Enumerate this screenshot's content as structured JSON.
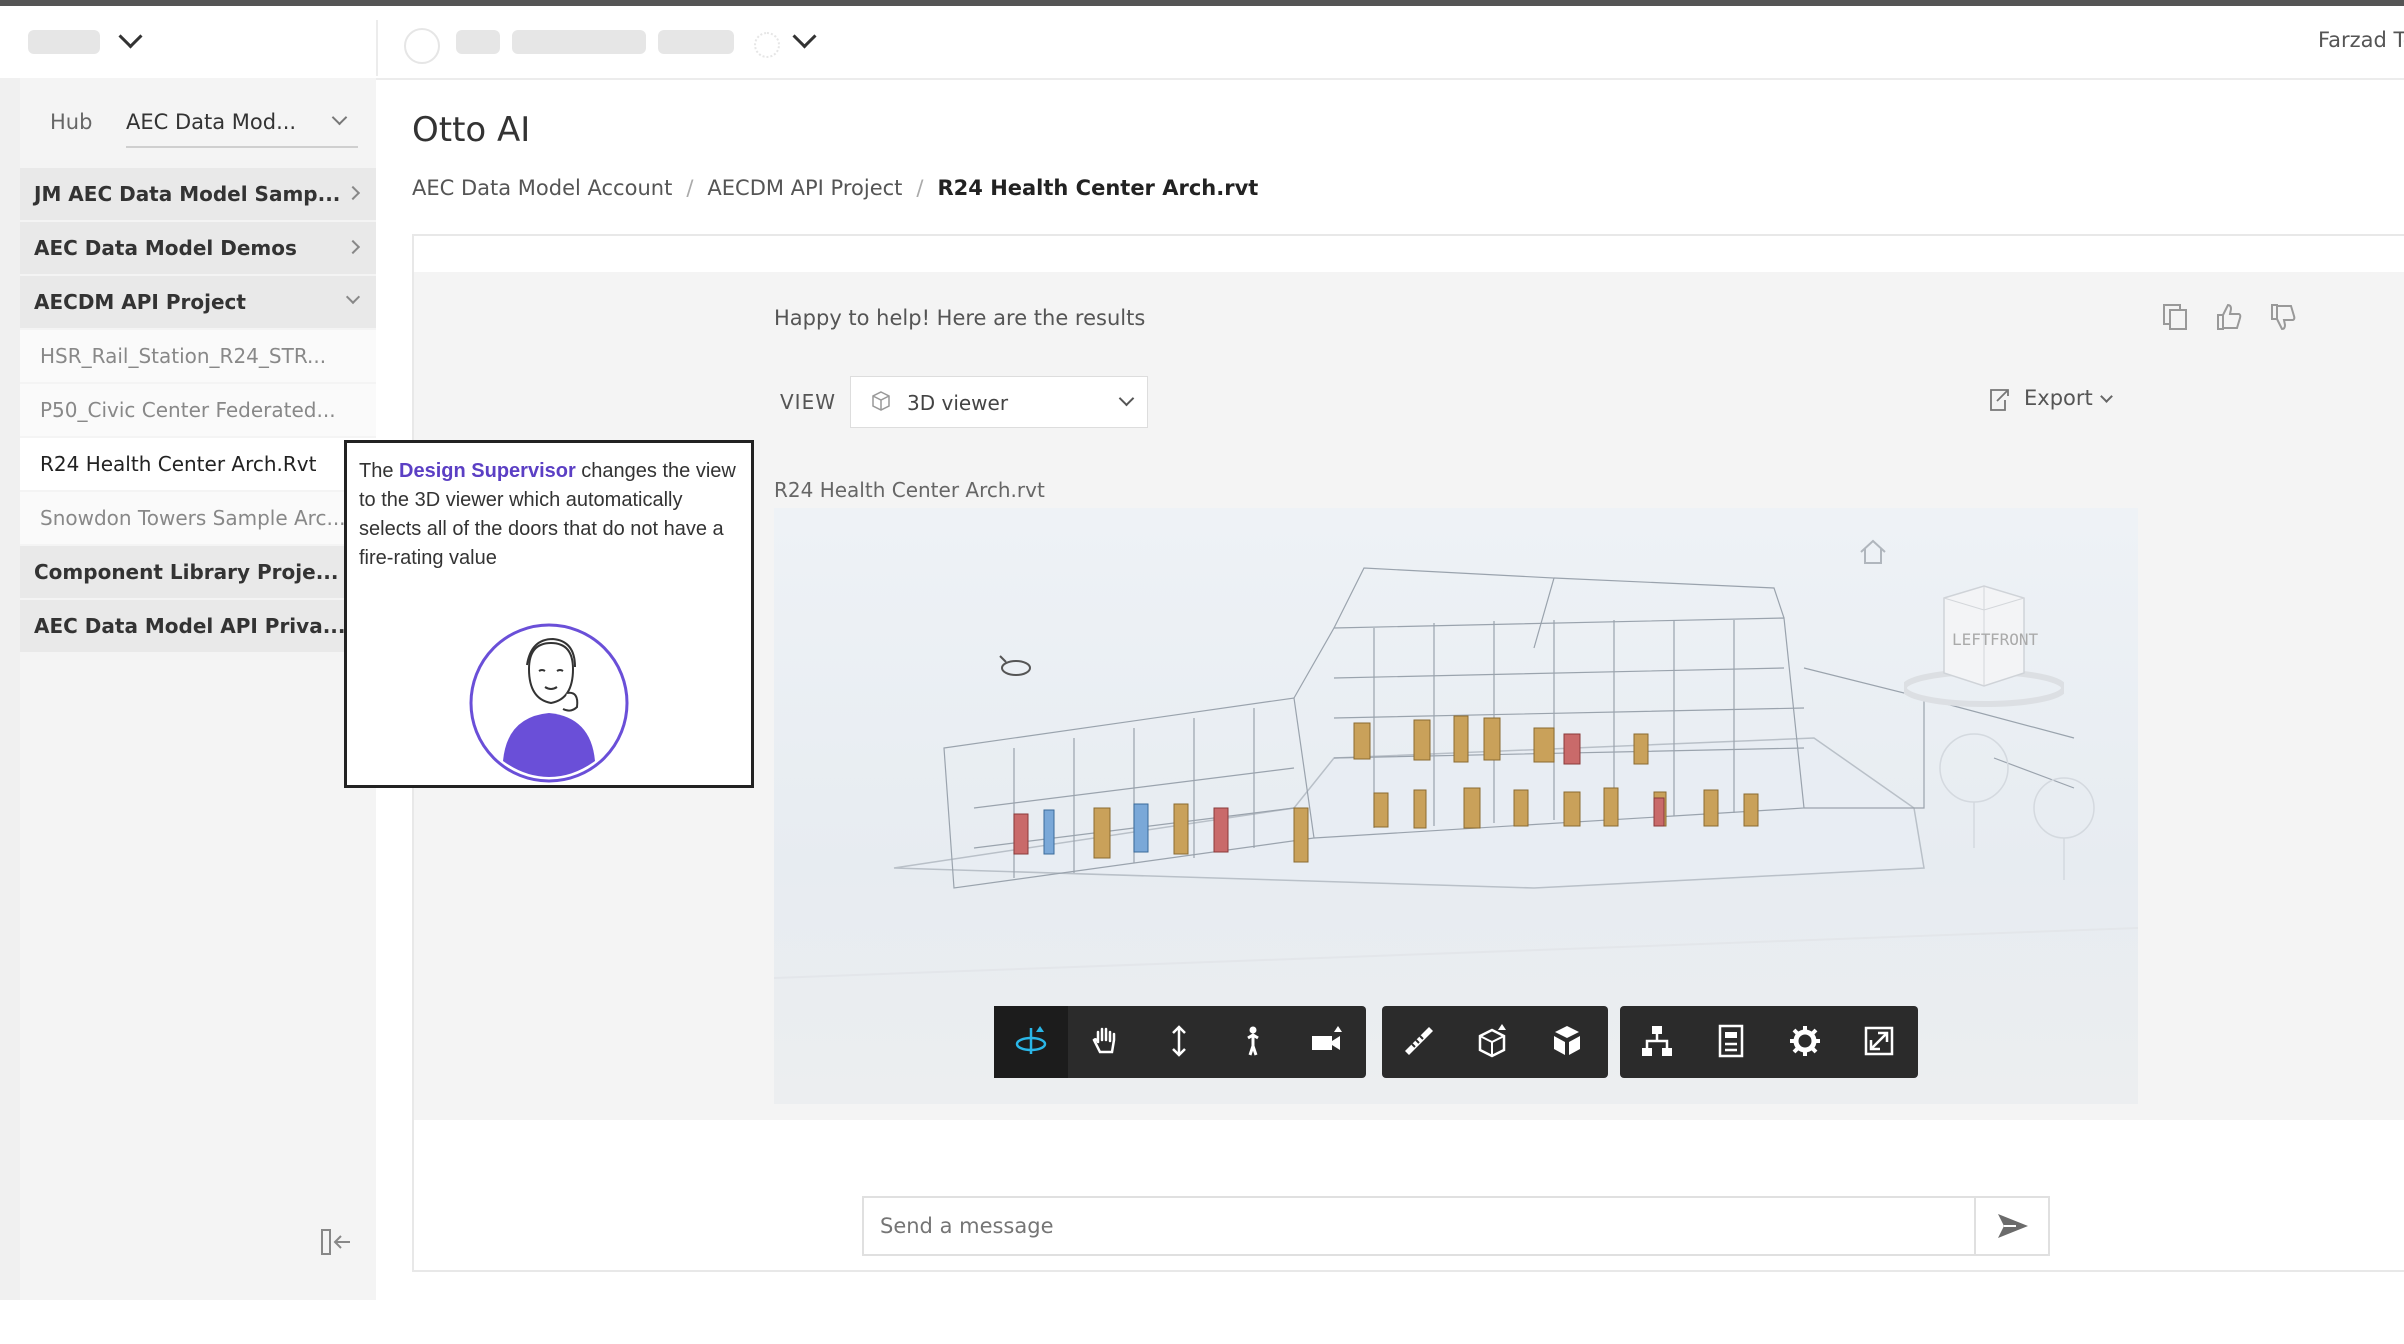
{
  "header": {
    "user_name": "Farzad To"
  },
  "sidebar": {
    "hub_label": "Hub",
    "hub_value": "AEC Data Mod...",
    "items": [
      {
        "label": "JM AEC Data Model Samp..."
      },
      {
        "label": "AEC Data Model Demos"
      },
      {
        "label": "AECDM API Project"
      }
    ],
    "sub_items": [
      {
        "label": "HSR_Rail_Station_R24_STR..."
      },
      {
        "label": "P50_Civic Center Federated..."
      },
      {
        "label": "R24 Health Center Arch.Rvt"
      },
      {
        "label": "Snowdon Towers Sample Arc..."
      }
    ],
    "items_after": [
      {
        "label": "Component Library Proje..."
      },
      {
        "label": "AEC Data Model API Priva..."
      }
    ]
  },
  "main": {
    "title": "Otto AI",
    "breadcrumbs": [
      "AEC Data Model Account",
      "AECDM API Project",
      "R24 Health Center Arch.rvt"
    ],
    "reply_text": "Happy to help! Here are the results",
    "view_label": "VIEW",
    "view_value": "3D viewer",
    "export_label": "Export",
    "model_name": "R24 Health Center Arch.rvt",
    "message_placeholder": "Send a message"
  },
  "tooltip": {
    "text_before": "The ",
    "highlight": "Design Supervisor",
    "text_after": " changes the view to the 3D viewer which automatically selects all of the doors that do not have a fire-rating value"
  },
  "viewcube": {
    "left": "LEFT",
    "front": "FRONT"
  },
  "colors": {
    "accent_purple": "#5b3fc4",
    "toolbar_bg": "#2b2b2b",
    "orbit_active": "#2ab7e8"
  },
  "toolbar_icons": [
    "orbit-icon",
    "pan-icon",
    "zoom-icon",
    "walk-icon",
    "camera-icon",
    "measure-icon",
    "section-icon",
    "explode-icon",
    "model-browser-icon",
    "properties-icon",
    "settings-icon",
    "fullscreen-icon"
  ]
}
